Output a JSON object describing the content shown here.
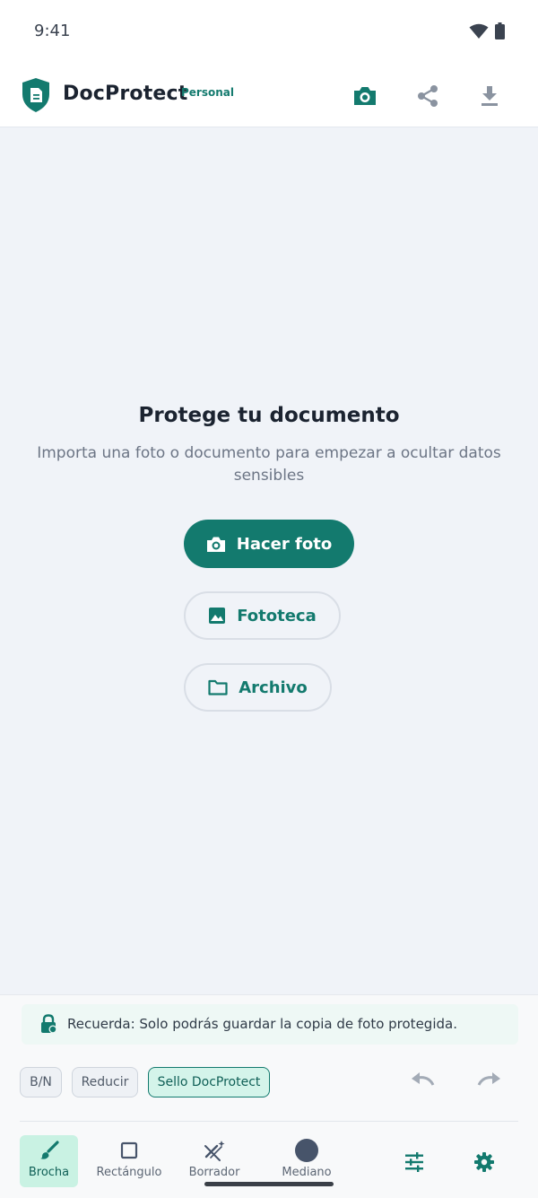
{
  "status": {
    "time": "9:41"
  },
  "header": {
    "brand": "DocProtect",
    "brand_badge": "Personal"
  },
  "empty_state": {
    "title": "Protege tu documento",
    "subtitle": "Importa una foto o documento para empezar a ocultar datos sensibles",
    "take_photo": "Hacer foto",
    "gallery": "Fototeca",
    "file": "Archivo"
  },
  "notice": {
    "text": "Recuerda: Solo podrás guardar la copia de foto protegida."
  },
  "chips": {
    "bw": "B/N",
    "reduce": "Reducir",
    "seal": "Sello DocProtect"
  },
  "tools": {
    "brush": "Brocha",
    "rectangle": "Rectángulo",
    "eraser": "Borrador",
    "size": "Mediano"
  },
  "colors": {
    "accent": "#137a6e",
    "accent_light": "#c9f2e3",
    "background": "#f0f3f8",
    "size_dot": "#47546a"
  }
}
